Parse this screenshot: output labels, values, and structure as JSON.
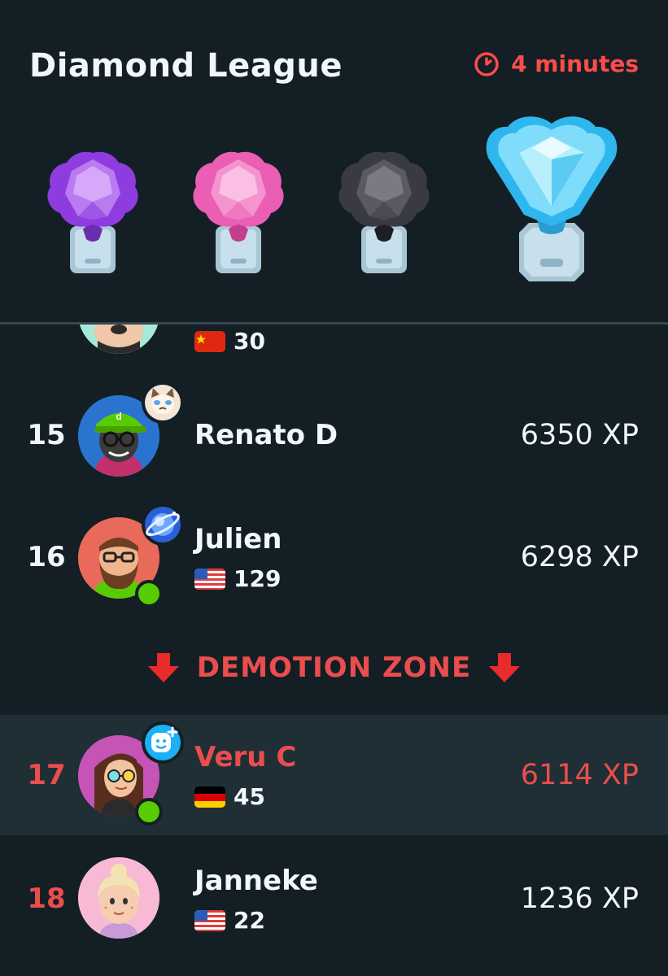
{
  "header": {
    "title": "Diamond League",
    "timer": "4 minutes",
    "timer_icon": "clock-icon",
    "accent": "#ff4b4b"
  },
  "trophies": [
    {
      "name": "amethyst-trophy",
      "color": "#9d4ae3"
    },
    {
      "name": "pearl-trophy",
      "color": "#f06ec0"
    },
    {
      "name": "obsidian-trophy",
      "color": "#4a4a55"
    },
    {
      "name": "diamond-trophy",
      "color": "#3cc6f0"
    }
  ],
  "partial_row": {
    "flag": "china-flag",
    "streak": "30"
  },
  "rows": [
    {
      "rank": "15",
      "name": "Renato D",
      "xp": "6350 XP",
      "badge": "cat-badge-icon"
    },
    {
      "rank": "16",
      "name": "Julien",
      "flag": "usa-flag",
      "streak": "129",
      "xp": "6298 XP",
      "badge": "galaxy-badge-icon",
      "online": true
    },
    {
      "rank": "17",
      "name": "Veru C",
      "flag": "germany-flag",
      "streak": "45",
      "xp": "6114 XP",
      "badge": "smile-plus-badge-icon",
      "online": true,
      "highlighted": true
    },
    {
      "rank": "18",
      "name": "Janneke",
      "flag": "usa-flag",
      "streak": "22",
      "xp": "1236 XP"
    }
  ],
  "demotion_zone": {
    "label": "DEMOTION ZONE",
    "icon": "arrow-down-icon",
    "color": "#ea4d4d"
  }
}
